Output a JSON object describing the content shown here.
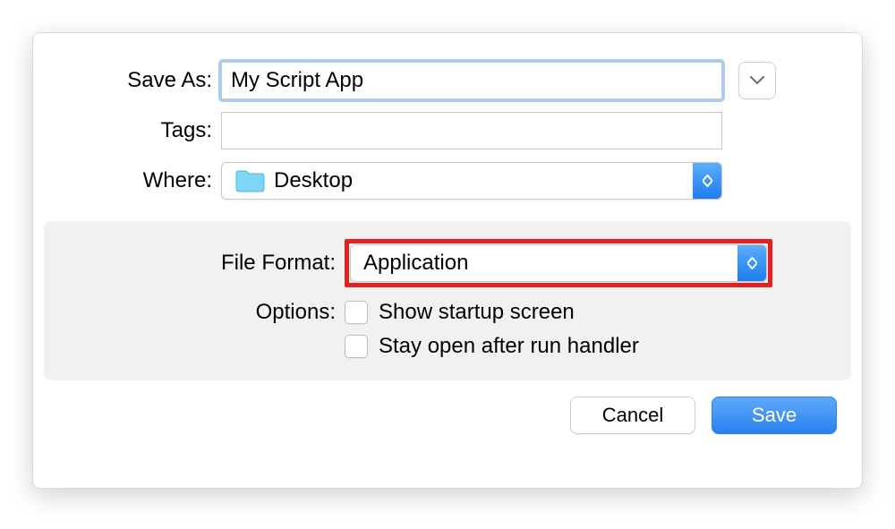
{
  "labels": {
    "save_as": "Save As:",
    "tags": "Tags:",
    "where": "Where:",
    "file_format": "File Format:",
    "options": "Options:"
  },
  "save_as_value": "My Script App",
  "tags_value": "",
  "where_value": "Desktop",
  "file_format_value": "Application",
  "option_checkboxes": {
    "show_startup": "Show startup screen",
    "stay_open": "Stay open after run handler"
  },
  "buttons": {
    "cancel": "Cancel",
    "save": "Save"
  },
  "colors": {
    "highlight_border": "#e42021",
    "focus_ring": "#a7cbf3",
    "primary_blue": "#2a80f0"
  }
}
